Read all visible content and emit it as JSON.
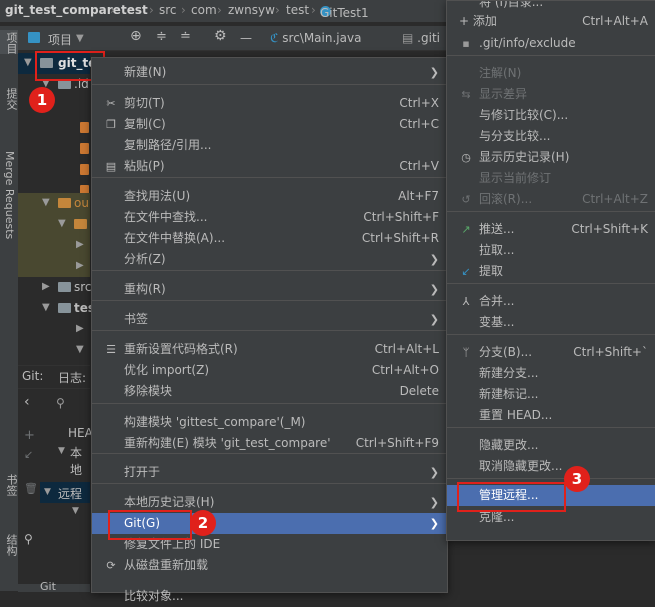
{
  "breadcrumb": {
    "items": [
      "git_test_compare",
      "test",
      "src",
      "com",
      "zwnsyw",
      "test",
      "GitTest1"
    ],
    "sep": "›"
  },
  "toolbar": {
    "project_label": "项目",
    "tab1": "src\\Main.java",
    "tab2": ".giti"
  },
  "left_stripe": {
    "project": "项目",
    "commit": "提交",
    "merge_requests": "Merge Requests",
    "bookmarks": "书签",
    "structure": "结构"
  },
  "tree": {
    "root": "git_te",
    "idea": ".id",
    "out": "ou",
    "src": "src",
    "test": "tes"
  },
  "git_panel": {
    "git_label": "Git:",
    "log_label": "日志:",
    "head": "HEA",
    "local": "本地",
    "remote": "远程",
    "bottom_tab": "Git"
  },
  "context_menu": {
    "items": [
      {
        "label": "新建(N)",
        "submenu": true
      },
      {
        "label": "剪切(T)",
        "shortcut": "Ctrl+X",
        "icon": "scissors-icon"
      },
      {
        "label": "复制(C)",
        "shortcut": "Ctrl+C",
        "icon": "copy-icon"
      },
      {
        "label": "复制路径/引用..."
      },
      {
        "label": "粘贴(P)",
        "shortcut": "Ctrl+V",
        "icon": "paste-icon"
      },
      {
        "label": "查找用法(U)",
        "shortcut": "Alt+F7"
      },
      {
        "label": "在文件中查找...",
        "shortcut": "Ctrl+Shift+F"
      },
      {
        "label": "在文件中替换(A)...",
        "shortcut": "Ctrl+Shift+R"
      },
      {
        "label": "分析(Z)",
        "submenu": true
      },
      {
        "label": "重构(R)",
        "submenu": true
      },
      {
        "label": "书签",
        "submenu": true
      },
      {
        "label": "重新设置代码格式(R)",
        "shortcut": "Ctrl+Alt+L",
        "icon": "format-icon"
      },
      {
        "label": "优化 import(Z)",
        "shortcut": "Ctrl+Alt+O"
      },
      {
        "label": "移除模块",
        "shortcut": "Delete"
      },
      {
        "label": "构建模块 'gittest_compare'(_M)"
      },
      {
        "label": "重新构建(E) 模块 'git_test_compare'",
        "shortcut": "Ctrl+Shift+F9"
      },
      {
        "label": "打开于",
        "submenu": true
      },
      {
        "label": "本地历史记录(H)",
        "submenu": true
      },
      {
        "label": "Git(G)",
        "submenu": true
      },
      {
        "label": "修复文件上的 IDE"
      },
      {
        "label": "从磁盘重新加载",
        "icon": "reload-icon"
      },
      {
        "label": "比较对象..."
      }
    ]
  },
  "git_submenu": {
    "items": [
      {
        "label": "+ 添加",
        "shortcut": "Ctrl+Alt+A"
      },
      {
        "label": ".git/info/exclude"
      },
      {
        "label": "注解(N)",
        "disabled": true
      },
      {
        "label": "显示差异",
        "disabled": true
      },
      {
        "label": "与修订比较(C)..."
      },
      {
        "label": "与分支比较..."
      },
      {
        "label": "显示历史记录(H)"
      },
      {
        "label": "显示当前修订",
        "disabled": true
      },
      {
        "label": "回滚(R)...",
        "shortcut": "Ctrl+Alt+Z",
        "disabled": true
      },
      {
        "label": "推送...",
        "shortcut": "Ctrl+Shift+K"
      },
      {
        "label": "拉取..."
      },
      {
        "label": "提取"
      },
      {
        "label": "合并..."
      },
      {
        "label": "变基..."
      },
      {
        "label": "分支(B)...",
        "shortcut": "Ctrl+Shift+`"
      },
      {
        "label": "新建分支..."
      },
      {
        "label": "新建标记..."
      },
      {
        "label": "重置 HEAD..."
      },
      {
        "label": "隐藏更改..."
      },
      {
        "label": "取消隐藏更改..."
      },
      {
        "label": "管理远程..."
      },
      {
        "label": "克隆..."
      }
    ],
    "top_cut": "将 (I)目录..."
  },
  "annotations": {
    "one": "1",
    "two": "2",
    "three": "3"
  }
}
